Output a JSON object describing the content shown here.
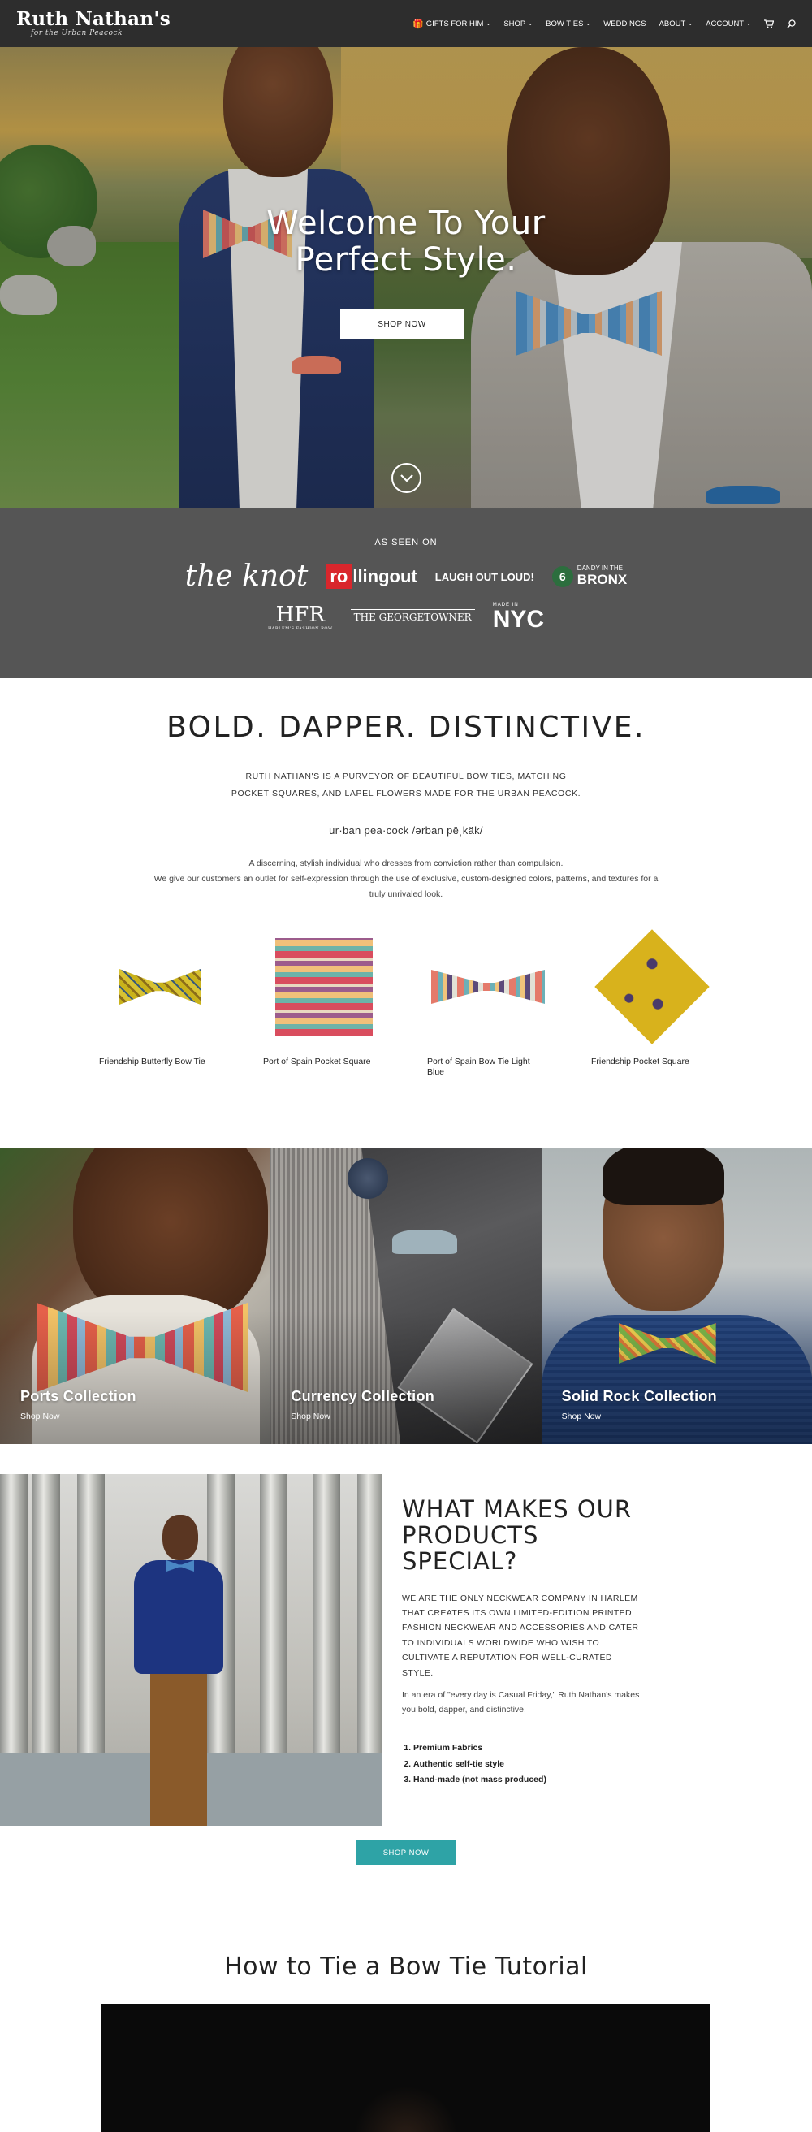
{
  "brand": {
    "name": "Ruth Nathan's",
    "tagline": "for the Urban Peacock"
  },
  "nav": {
    "items": [
      {
        "label": "GIFTS FOR HIM",
        "dropdown": true,
        "icon": "gift-icon"
      },
      {
        "label": "SHOP",
        "dropdown": true
      },
      {
        "label": "BOW TIES",
        "dropdown": true
      },
      {
        "label": "WEDDINGS",
        "dropdown": false
      },
      {
        "label": "ABOUT",
        "dropdown": true
      },
      {
        "label": "ACCOUNT",
        "dropdown": true
      }
    ],
    "cart_icon": "cart-icon",
    "search_icon": "search-icon"
  },
  "hero": {
    "title_line1": "Welcome To Your",
    "title_line2": "Perfect Style.",
    "button": "SHOP NOW",
    "scroll_icon": "chevron-down-circle-icon"
  },
  "seen_on": {
    "label": "AS SEEN ON",
    "logos": {
      "knot": "the knot",
      "rollingout_ro": "ro",
      "rollingout_rest": "llingout",
      "laugh": "LAUGH OUT LOUD!",
      "dandy_number": "6",
      "dandy_top": "DANDY IN THE",
      "dandy_bronx": "BRONX",
      "hfr": "HFR",
      "hfr_sub": "HARLEM'S FASHION ROW",
      "georgetowner": "THE GEORGETOWNER",
      "nyc_small": "MADE IN",
      "nyc": "NYC"
    }
  },
  "about": {
    "title": "BOLD. DAPPER. DISTINCTIVE.",
    "intro_line1": "RUTH NATHAN'S IS A PURVEYOR OF BEAUTIFUL BOW TIES, MATCHING",
    "intro_line2": "POCKET SQUARES, AND LAPEL FLOWERS MADE FOR THE URBAN PEACOCK.",
    "pronunciation": "ur·ban pea·cock /ərban pē͟ˌkäk/",
    "desc_line1": "A discerning, stylish individual who dresses from conviction rather than compulsion.",
    "desc_line2": "We give our customers an outlet for self-expression through the use of exclusive, custom-designed colors, patterns, and textures for a truly unrivaled look."
  },
  "products": [
    {
      "name": "Friendship Butterfly Bow Tie"
    },
    {
      "name": "Port of Spain Pocket Square"
    },
    {
      "name": "Port of Spain Bow Tie Light Blue"
    },
    {
      "name": "Friendship Pocket Square"
    }
  ],
  "collections": [
    {
      "title": "Ports Collection",
      "link": "Shop Now"
    },
    {
      "title": "Currency Collection",
      "link": "Shop Now"
    },
    {
      "title": "Solid Rock Collection",
      "link": "Shop Now"
    }
  ],
  "special": {
    "title": "WHAT MAKES OUR PRODUCTS SPECIAL?",
    "lead": "WE ARE THE ONLY NECKWEAR COMPANY IN HARLEM THAT CREATES ITS OWN LIMITED-EDITION PRINTED FASHION NECKWEAR AND ACCESSORIES AND CATER TO INDIVIDUALS WORLDWIDE WHO WISH TO CULTIVATE A REPUTATION FOR WELL-CURATED STYLE.",
    "paragraph": "In an era of \"every day is Casual Friday,\" Ruth Nathan's makes you bold, dapper, and distinctive.",
    "list": [
      "Premium Fabrics",
      "Authentic self-tie style",
      "Hand-made (not mass produced)"
    ],
    "button": "SHOP NOW"
  },
  "tutorial": {
    "title": "How to Tie a Bow Tie Tutorial"
  },
  "colors": {
    "header_bg": "#2d2d2d",
    "seen_bg": "#555555",
    "accent_teal": "#2ea3a6"
  }
}
